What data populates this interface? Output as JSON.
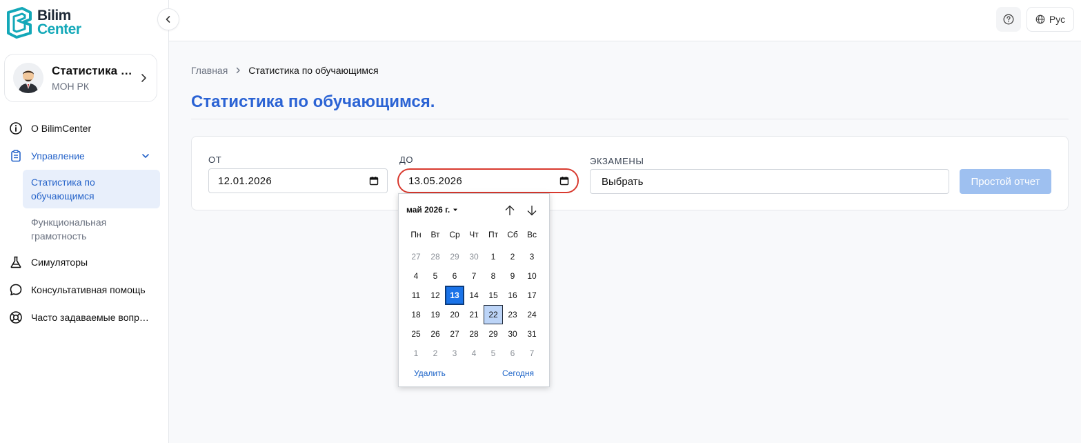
{
  "brand": {
    "line1": "Bilim",
    "line2": "Center"
  },
  "profile": {
    "name": "Статистика по обучающимся",
    "org": "МОН РК"
  },
  "nav": {
    "about": "О BilimCenter",
    "management": "Управление",
    "sub_items": [
      "Статистика по обучающимся",
      "Функциональная грамотность"
    ],
    "simulators": "Симуляторы",
    "consult": "Консультативная помощь",
    "faq": "Часто задаваемые вопросы"
  },
  "topbar": {
    "lang": "Рус"
  },
  "breadcrumb": {
    "home": "Главная",
    "current": "Статистика по обучающимся"
  },
  "page": {
    "title": "Статистика по обучающимся."
  },
  "filters": {
    "from_label": "ОТ",
    "from_value": "12.01.2026",
    "to_label": "ДО",
    "to_value": "13.05.2026",
    "exams_label": "ЭКЗАМЕНЫ",
    "exams_value": "Выбрать",
    "report_button": "Простой отчет"
  },
  "picker": {
    "month": "май 2026 г.",
    "weekdays": [
      "Пн",
      "Вт",
      "Ср",
      "Чт",
      "Пт",
      "Сб",
      "Вс"
    ],
    "days": [
      {
        "d": "27",
        "m": true
      },
      {
        "d": "28",
        "m": true
      },
      {
        "d": "29",
        "m": true
      },
      {
        "d": "30",
        "m": true
      },
      {
        "d": "1"
      },
      {
        "d": "2"
      },
      {
        "d": "3"
      },
      {
        "d": "4"
      },
      {
        "d": "5"
      },
      {
        "d": "6"
      },
      {
        "d": "7"
      },
      {
        "d": "8"
      },
      {
        "d": "9"
      },
      {
        "d": "10"
      },
      {
        "d": "11"
      },
      {
        "d": "12"
      },
      {
        "d": "13",
        "s": true
      },
      {
        "d": "14"
      },
      {
        "d": "15"
      },
      {
        "d": "16"
      },
      {
        "d": "17"
      },
      {
        "d": "18"
      },
      {
        "d": "19"
      },
      {
        "d": "20"
      },
      {
        "d": "21"
      },
      {
        "d": "22",
        "t": true
      },
      {
        "d": "23"
      },
      {
        "d": "24"
      },
      {
        "d": "25"
      },
      {
        "d": "26"
      },
      {
        "d": "27"
      },
      {
        "d": "28"
      },
      {
        "d": "29"
      },
      {
        "d": "30"
      },
      {
        "d": "31"
      },
      {
        "d": "1",
        "m": true
      },
      {
        "d": "2",
        "m": true
      },
      {
        "d": "3",
        "m": true
      },
      {
        "d": "4",
        "m": true
      },
      {
        "d": "5",
        "m": true
      },
      {
        "d": "6",
        "m": true
      },
      {
        "d": "7",
        "m": true
      }
    ],
    "clear": "Удалить",
    "today": "Сегодня"
  },
  "colors": {
    "accent": "#2b63d4",
    "brand_teal": "#13a8b8",
    "focus_ring": "#d8392e",
    "button_disabled": "#9ec0f0"
  },
  "icons": [
    "logo-icon",
    "chevron-left-icon",
    "chevron-right-icon",
    "help-icon",
    "globe-icon",
    "info-icon",
    "clipboard-icon",
    "chevron-down-icon",
    "flask-icon",
    "chat-icon",
    "lifebuoy-icon",
    "calendar-icon",
    "caret-down-icon",
    "arrow-up-icon",
    "arrow-down-icon"
  ]
}
